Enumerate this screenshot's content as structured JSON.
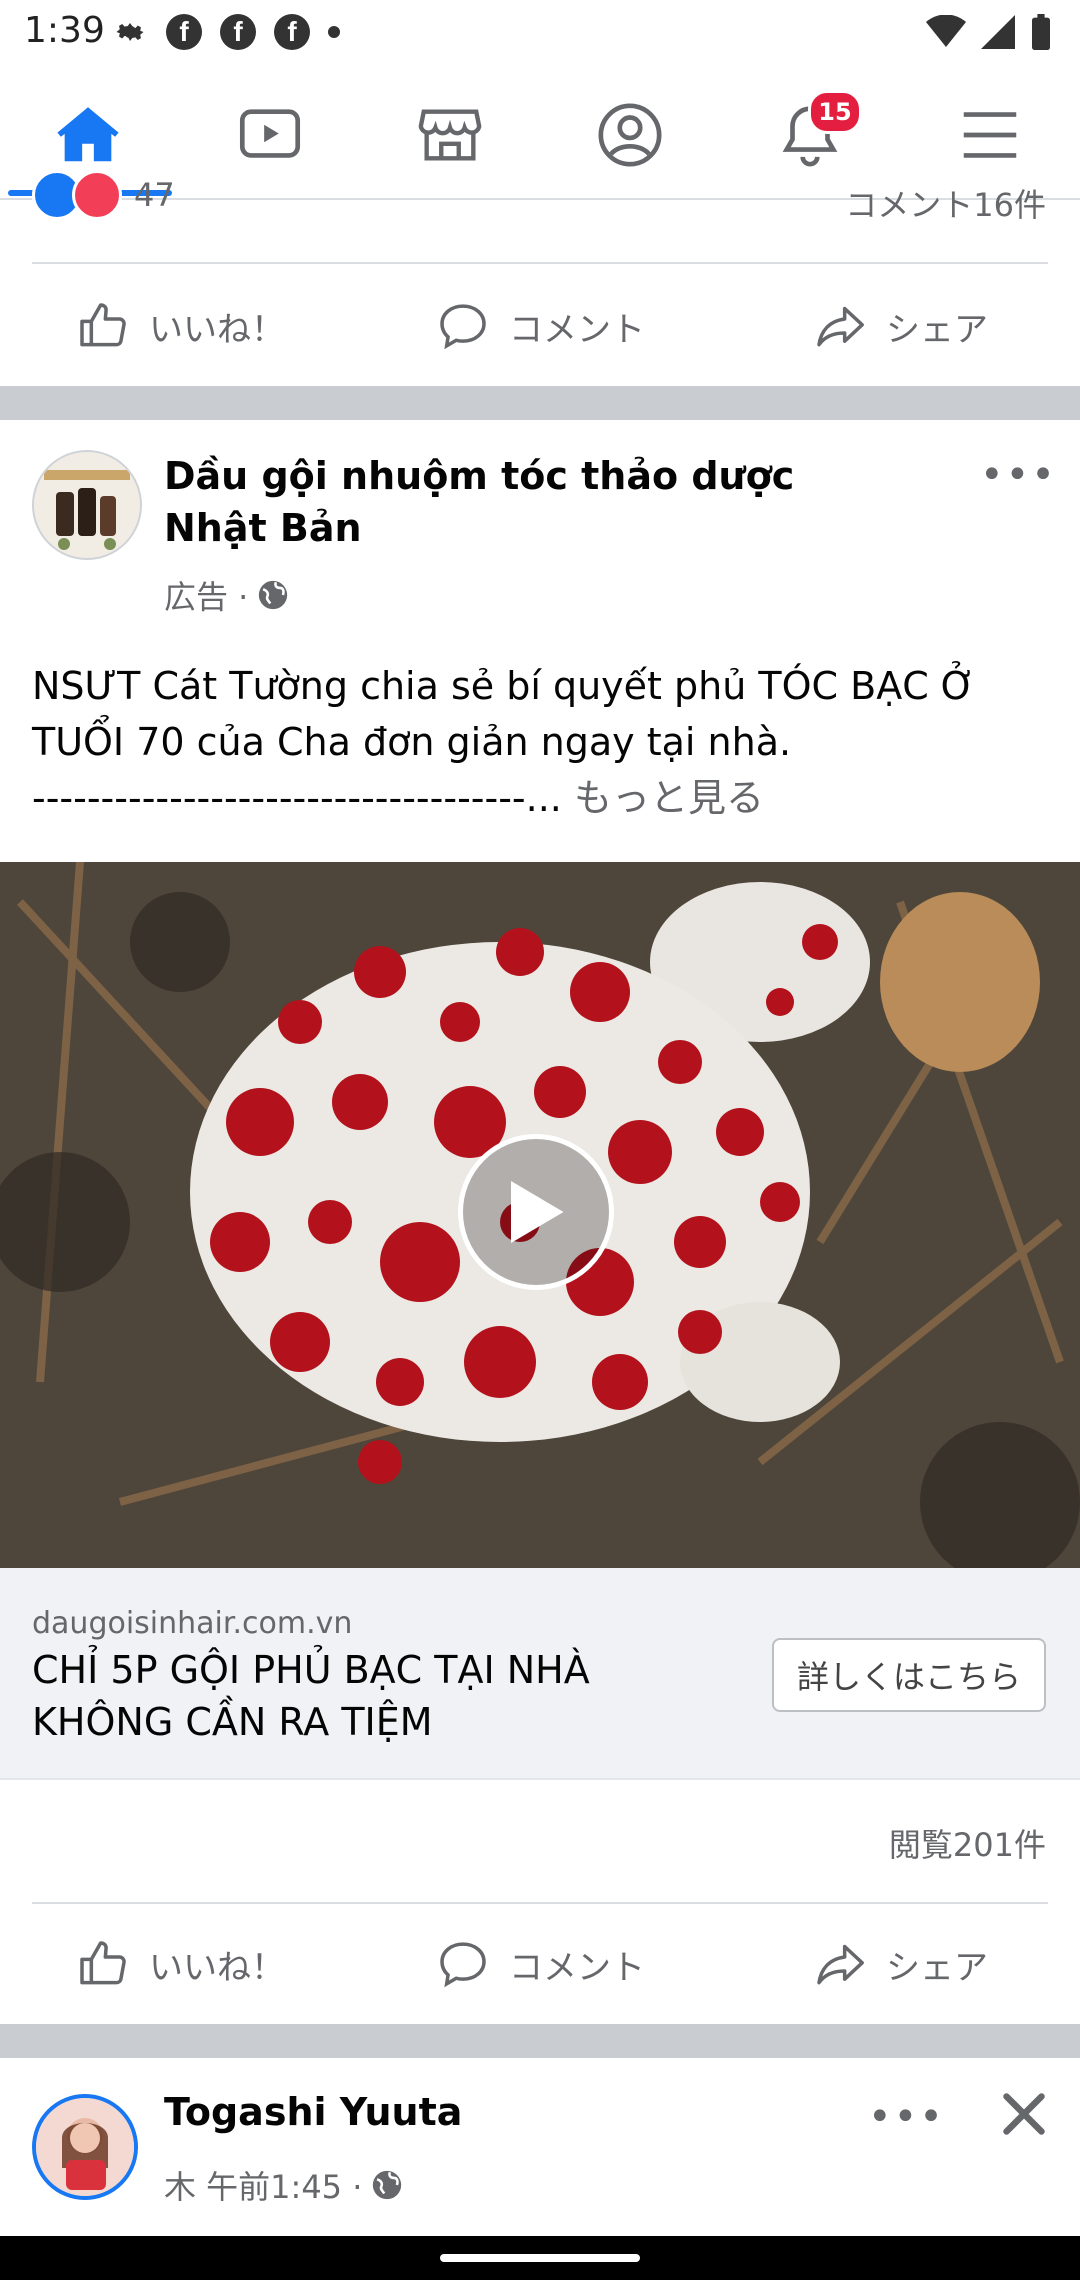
{
  "status_bar": {
    "time": "1:39"
  },
  "nav": {
    "items": [
      "home-icon",
      "video-icon",
      "marketplace-icon",
      "profile-icon",
      "notifications-icon",
      "menu-icon"
    ],
    "notification_count": "15",
    "accent": "#1877f2"
  },
  "prev_post": {
    "reaction_count": "47",
    "comment_count": "コメント16件",
    "actions": {
      "like": "いいね！",
      "comment": "コメント",
      "share": "シェア"
    }
  },
  "ad_post": {
    "page_name": "Dầu gội nhuộm tóc thảo dược Nhật Bản",
    "meta": "広告 ·",
    "text_line1": "NSƯT Cát Tường chia sẻ bí quyết phủ TÓC BẠC Ở",
    "text_line2": "TUỔI 70 của Cha đơn giản ngay tại nhà.",
    "text_line3": "------------------------------------...",
    "see_more": "もっと見る",
    "link_domain": "daugoisinhair.com.vn",
    "link_title_line1": "CHỈ 5P GỘI PHỦ BẠC TẠI NHÀ",
    "link_title_line2": "KHÔNG CẦN RA TIỆM",
    "cta": "詳しくはこちら",
    "views": "閲覧201件",
    "actions": {
      "like": "いいね！",
      "comment": "コメント",
      "share": "シェア"
    }
  },
  "next_post": {
    "author": "Togashi Yuuta",
    "meta": "木 午前1:45 ·"
  }
}
